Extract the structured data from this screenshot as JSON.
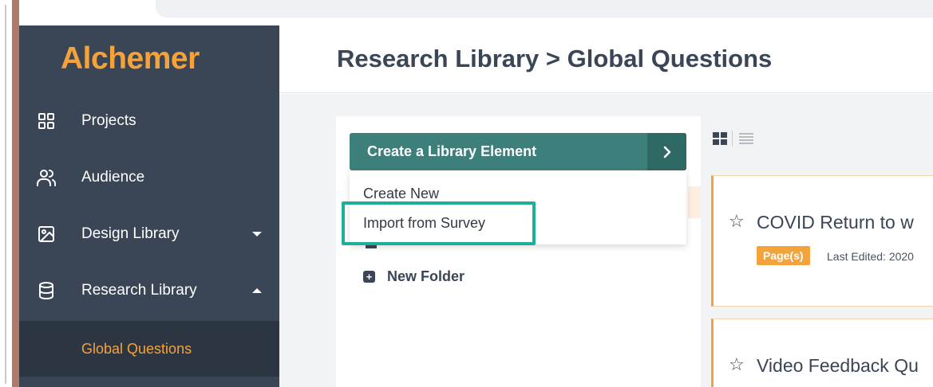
{
  "colors": {
    "sidebar_bg": "#3a4656",
    "brand_orange": "#f5a23a",
    "primary_button": "#3d7f7a",
    "highlight": "#1fae97"
  },
  "sidebar": {
    "logo": "Alchemer",
    "items": [
      {
        "label": "Projects",
        "icon": "grid-icon"
      },
      {
        "label": "Audience",
        "icon": "users-icon"
      },
      {
        "label": "Design Library",
        "icon": "image-icon",
        "caret": "down"
      },
      {
        "label": "Research Library",
        "icon": "database-icon",
        "caret": "up"
      }
    ],
    "subitem": {
      "label": "Global Questions",
      "active": true
    }
  },
  "header": {
    "title": "Research Library > Global Questions"
  },
  "panel": {
    "create_button": "Create a Library Element",
    "dropdown": [
      "Create New",
      "Import from Survey"
    ],
    "new_folder": "New Folder"
  },
  "cards": [
    {
      "title": "COVID Return to w",
      "badge": "Page(s)",
      "edited": "Last Edited: 2020"
    },
    {
      "title": "Video Feedback Qu"
    }
  ]
}
